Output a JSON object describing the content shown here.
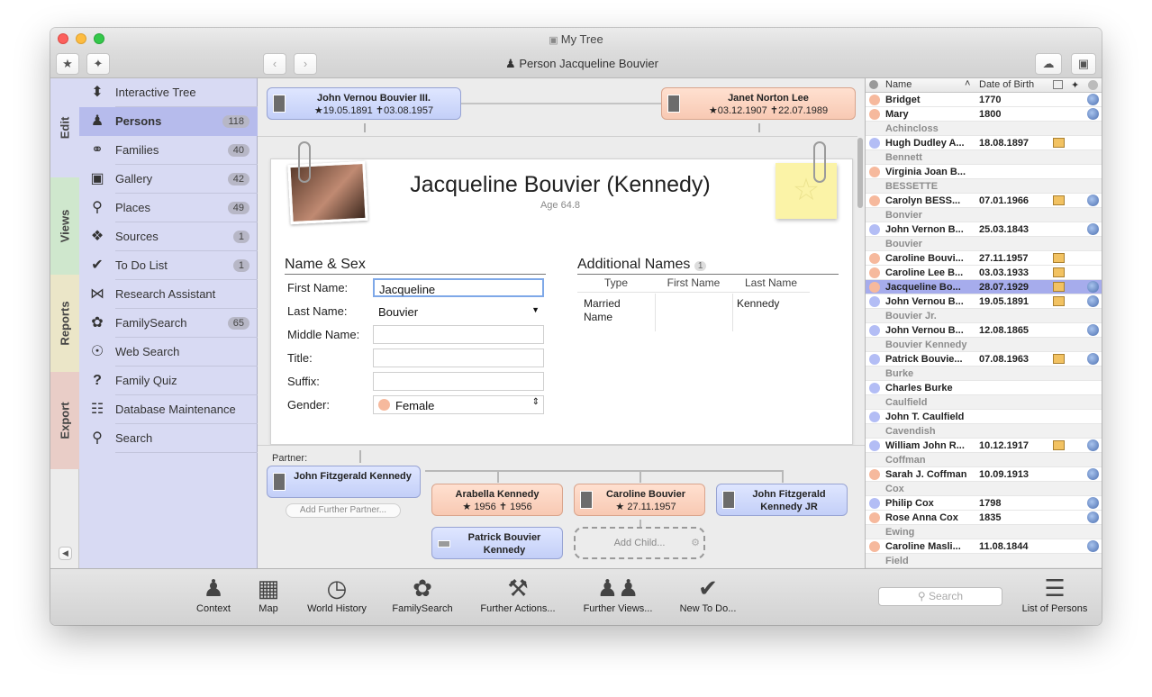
{
  "window": {
    "title": "My Tree",
    "breadcrumb": "Person Jacqueline Bouvier"
  },
  "colors": {
    "accent": "#a6acec",
    "male": "#b3bdf5",
    "female": "#f6b99d",
    "sidebar": "#d8daf3"
  },
  "tabs": [
    "Edit",
    "Views",
    "Reports",
    "Export"
  ],
  "sidebar": {
    "items": [
      {
        "label": "Interactive Tree",
        "icon": "tree-icon",
        "badge": ""
      },
      {
        "label": "Persons",
        "icon": "person-icon",
        "badge": "118"
      },
      {
        "label": "Families",
        "icon": "rings-icon",
        "badge": "40"
      },
      {
        "label": "Gallery",
        "icon": "gallery-icon",
        "badge": "42"
      },
      {
        "label": "Places",
        "icon": "pin-icon",
        "badge": "49"
      },
      {
        "label": "Sources",
        "icon": "book-icon",
        "badge": "1"
      },
      {
        "label": "To Do List",
        "icon": "check-icon",
        "badge": "1"
      },
      {
        "label": "Research Assistant",
        "icon": "bowtie-icon",
        "badge": ""
      },
      {
        "label": "FamilySearch",
        "icon": "familysearch-icon",
        "badge": "65"
      },
      {
        "label": "Web Search",
        "icon": "web-search-icon",
        "badge": ""
      },
      {
        "label": "Family Quiz",
        "icon": "question-icon",
        "badge": ""
      },
      {
        "label": "Database Maintenance",
        "icon": "database-icon",
        "badge": ""
      },
      {
        "label": "Search",
        "icon": "search-icon",
        "badge": ""
      }
    ]
  },
  "parents": {
    "father": {
      "name": "John Vernou Bouvier III.",
      "birth": "19.05.1891",
      "death": "03.08.1957"
    },
    "mother": {
      "name": "Janet Norton Lee",
      "birth": "03.12.1907",
      "death": "22.07.1989"
    }
  },
  "person": {
    "name": "Jacqueline Bouvier (Kennedy)",
    "age": "Age 64.8",
    "section_name_sex": "Name & Sex",
    "fields": {
      "first_name_label": "First Name:",
      "first_name": "Jacqueline",
      "last_name_label": "Last Name:",
      "last_name": "Bouvier",
      "middle_name_label": "Middle Name:",
      "middle_name": "",
      "title_label": "Title:",
      "title": "",
      "suffix_label": "Suffix:",
      "suffix": "",
      "gender_label": "Gender:",
      "gender": "Female"
    },
    "additional": {
      "title": "Additional Names",
      "count": "1",
      "headers": [
        "Type",
        "First Name",
        "Last Name"
      ],
      "row": {
        "type": "Married Name",
        "first": "",
        "last": "Kennedy"
      }
    }
  },
  "family": {
    "partner_label": "Partner:",
    "partner": "John Fitzgerald Kennedy",
    "add_partner": "Add Further Partner...",
    "children": [
      {
        "name": "Arabella Kennedy",
        "birth": "1956",
        "death": "1956"
      },
      {
        "name": "Caroline Bouvier",
        "birth": "27.11.1957",
        "death": ""
      },
      {
        "name": "John Fitzgerald Kennedy JR",
        "birth": "",
        "death": ""
      },
      {
        "name": "Patrick Bouvier Kennedy",
        "birth": "",
        "death": ""
      }
    ],
    "add_child": "Add Child..."
  },
  "list": {
    "headers": {
      "name": "Name",
      "dob": "Date of Birth"
    },
    "rows": [
      {
        "kind": "p",
        "sex": "f",
        "name": "Bridget",
        "dob": "1770",
        "photo": false,
        "globe": true
      },
      {
        "kind": "p",
        "sex": "f",
        "name": "Mary",
        "dob": "1800",
        "photo": false,
        "globe": true
      },
      {
        "kind": "g",
        "name": "Achincloss"
      },
      {
        "kind": "p",
        "sex": "m",
        "name": "Hugh Dudley A...",
        "dob": "18.08.1897",
        "photo": true,
        "globe": false
      },
      {
        "kind": "g",
        "name": "Bennett"
      },
      {
        "kind": "p",
        "sex": "f",
        "name": "Virginia Joan B...",
        "dob": "",
        "photo": false,
        "globe": false
      },
      {
        "kind": "g",
        "name": "BESSETTE"
      },
      {
        "kind": "p",
        "sex": "f",
        "name": "Carolyn BESS...",
        "dob": "07.01.1966",
        "photo": true,
        "globe": true
      },
      {
        "kind": "g",
        "name": "Bonvier"
      },
      {
        "kind": "p",
        "sex": "m",
        "name": "John Vernon B...",
        "dob": "25.03.1843",
        "photo": false,
        "globe": true
      },
      {
        "kind": "g",
        "name": "Bouvier"
      },
      {
        "kind": "p",
        "sex": "f",
        "name": "Caroline Bouvi...",
        "dob": "27.11.1957",
        "photo": true,
        "globe": false
      },
      {
        "kind": "p",
        "sex": "f",
        "name": "Caroline Lee B...",
        "dob": "03.03.1933",
        "photo": true,
        "globe": false
      },
      {
        "kind": "p",
        "sex": "f",
        "name": "Jacqueline Bo...",
        "dob": "28.07.1929",
        "photo": true,
        "globe": true,
        "selected": true
      },
      {
        "kind": "p",
        "sex": "m",
        "name": "John Vernou B...",
        "dob": "19.05.1891",
        "photo": true,
        "globe": true
      },
      {
        "kind": "g",
        "name": "Bouvier Jr."
      },
      {
        "kind": "p",
        "sex": "m",
        "name": "John Vernou B...",
        "dob": "12.08.1865",
        "photo": false,
        "globe": true
      },
      {
        "kind": "g",
        "name": "Bouvier Kennedy"
      },
      {
        "kind": "p",
        "sex": "m",
        "name": "Patrick Bouvie...",
        "dob": "07.08.1963",
        "photo": true,
        "globe": true
      },
      {
        "kind": "g",
        "name": "Burke"
      },
      {
        "kind": "p",
        "sex": "m",
        "name": "Charles Burke",
        "dob": "",
        "photo": false,
        "globe": false
      },
      {
        "kind": "g",
        "name": "Caulfield"
      },
      {
        "kind": "p",
        "sex": "m",
        "name": "John T. Caulfield",
        "dob": "",
        "photo": false,
        "globe": false
      },
      {
        "kind": "g",
        "name": "Cavendish"
      },
      {
        "kind": "p",
        "sex": "m",
        "name": "William John R...",
        "dob": "10.12.1917",
        "photo": true,
        "globe": true
      },
      {
        "kind": "g",
        "name": "Coffman"
      },
      {
        "kind": "p",
        "sex": "f",
        "name": "Sarah J. Coffman",
        "dob": "10.09.1913",
        "photo": false,
        "globe": true
      },
      {
        "kind": "g",
        "name": "Cox"
      },
      {
        "kind": "p",
        "sex": "m",
        "name": "Philip Cox",
        "dob": "1798",
        "photo": false,
        "globe": true
      },
      {
        "kind": "p",
        "sex": "f",
        "name": "Rose Anna Cox",
        "dob": "1835",
        "photo": false,
        "globe": true
      },
      {
        "kind": "g",
        "name": "Ewing"
      },
      {
        "kind": "p",
        "sex": "f",
        "name": "Caroline Masli...",
        "dob": "11.08.1844",
        "photo": false,
        "globe": true
      },
      {
        "kind": "g",
        "name": "Field"
      }
    ]
  },
  "bottom": {
    "buttons": [
      "Context",
      "Map",
      "World History",
      "FamilySearch",
      "Further Actions...",
      "Further Views...",
      "New To Do..."
    ],
    "search_placeholder": "Search",
    "list_label": "List of Persons"
  }
}
